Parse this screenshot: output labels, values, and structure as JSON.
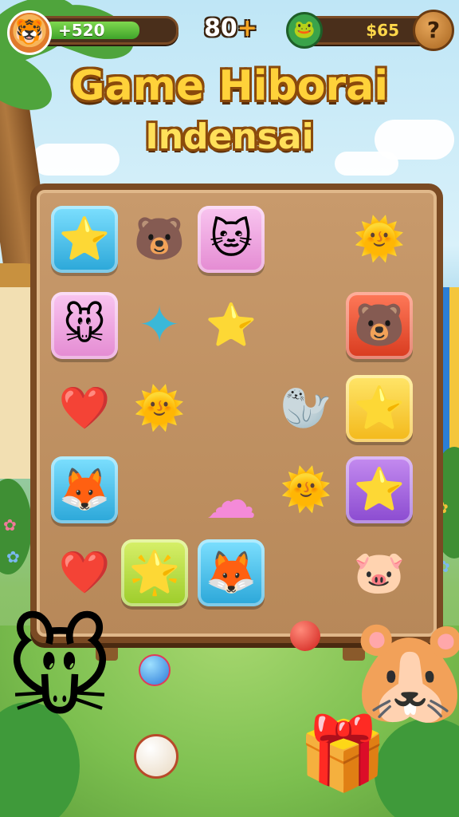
{
  "hud": {
    "score": "+520",
    "moves": "80",
    "moves_plus": "+",
    "money": "$65",
    "help_label": "?"
  },
  "title": {
    "line1": "Game Hiborai",
    "line2": "Indensai"
  },
  "board": {
    "tiles": [
      {
        "name": "star-tile",
        "glyph": "⭐",
        "box": "blue"
      },
      {
        "name": "bear-tile",
        "glyph": "🐻",
        "box": "none"
      },
      {
        "name": "cat-tile",
        "glyph": "🐱",
        "box": "pink"
      },
      {
        "name": "sun-creature-tile",
        "glyph": "🌞",
        "box": "none"
      },
      {
        "name": "mouse-tile",
        "glyph": "🐭",
        "box": "pink"
      },
      {
        "name": "blue-star-tile",
        "glyph": "✦",
        "box": "none"
      },
      {
        "name": "star-tile",
        "glyph": "⭐",
        "box": "none"
      },
      {
        "name": "bear-tile",
        "glyph": "🐻",
        "box": "red"
      },
      {
        "name": "heart-tile",
        "glyph": "❤️",
        "box": "none"
      },
      {
        "name": "sun-creature-tile",
        "glyph": "🌞",
        "box": "none"
      },
      {
        "name": "seal-tile",
        "glyph": "🦭",
        "box": "none"
      },
      {
        "name": "star-tile",
        "glyph": "⭐",
        "box": "yellow"
      },
      {
        "name": "fox-tile",
        "glyph": "🦊",
        "box": "blue"
      },
      {
        "name": "cloud-tile",
        "glyph": "☁",
        "box": "none"
      },
      {
        "name": "sun-creature-tile",
        "glyph": "🌞",
        "box": "none"
      },
      {
        "name": "star-tile",
        "glyph": "⭐",
        "box": "purple"
      },
      {
        "name": "heart-tile",
        "glyph": "❤️",
        "box": "none"
      },
      {
        "name": "happy-star-tile",
        "glyph": "🌟",
        "box": "lime"
      },
      {
        "name": "fox-tile",
        "glyph": "🦊",
        "box": "blue"
      },
      {
        "name": "pink-critter-tile",
        "glyph": "🐷",
        "box": "none"
      }
    ]
  },
  "scene": {
    "left_character": "🐭",
    "right_character": "🐹",
    "gift": "🎁"
  }
}
